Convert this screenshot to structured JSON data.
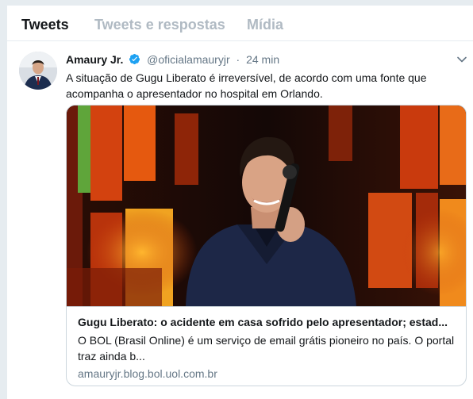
{
  "tabs": [
    {
      "label": "Tweets",
      "active": true
    },
    {
      "label": "Tweets e respostas",
      "active": false
    },
    {
      "label": "Mídia",
      "active": false
    }
  ],
  "tweet": {
    "author_name": "Amaury Jr.",
    "handle": "@oficialamauryjr",
    "separator": "·",
    "time": "24 min",
    "verified": true,
    "text": "A situação de Gugu Liberato é irreversível, de acordo com uma fonte que acompanha o apresentador no hospital em Orlando.",
    "card": {
      "title": "Gugu Liberato: o acidente em casa sofrido pelo apresentador; estad...",
      "description": "O BOL (Brasil Online) é um serviço de email grátis pioneiro no país. O portal traz ainda b...",
      "domain": "amauryjr.blog.bol.uol.com.br"
    }
  },
  "icons": {
    "verified": "verified-badge-icon",
    "caret": "chevron-down-icon"
  },
  "colors": {
    "accent": "#1da1f2",
    "text_primary": "#14171a",
    "text_secondary": "#657786",
    "tab_inactive": "#b0bac3",
    "border": "#ccd6dd",
    "background": "#e6ecf0"
  }
}
